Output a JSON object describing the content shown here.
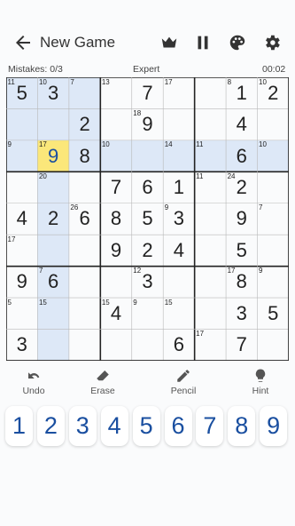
{
  "header": {
    "title": "New Game"
  },
  "status": {
    "mistakes": "Mistakes: 0/3",
    "difficulty": "Expert",
    "timer": "00:02"
  },
  "icons": {
    "back": "arrow-left-icon",
    "crown": "crown-icon",
    "pause": "pause-icon",
    "theme": "palette-icon",
    "settings": "gear-icon"
  },
  "colors": {
    "accent": "#1a4fa0",
    "selected": "#fbe77a",
    "highlight": "#dde8f7",
    "gridline": "#222222"
  },
  "grid": [
    [
      "5",
      "3",
      "",
      "",
      "7",
      "",
      "",
      "1",
      "2"
    ],
    [
      "",
      "",
      "2",
      "",
      "9",
      "",
      "",
      "4",
      ""
    ],
    [
      "",
      "9",
      "8",
      "",
      "",
      "",
      "",
      "6",
      ""
    ],
    [
      "",
      "",
      "",
      "7",
      "6",
      "1",
      "",
      "2",
      ""
    ],
    [
      "4",
      "2",
      "6",
      "8",
      "5",
      "3",
      "",
      "9",
      ""
    ],
    [
      "",
      "",
      "",
      "9",
      "2",
      "4",
      "",
      "5",
      ""
    ],
    [
      "9",
      "6",
      "",
      "",
      "3",
      "",
      "",
      "8",
      ""
    ],
    [
      "",
      "",
      "",
      "4",
      "",
      "",
      "",
      "3",
      "5"
    ],
    [
      "3",
      "",
      "",
      "",
      "",
      "6",
      "",
      "7",
      ""
    ]
  ],
  "selected_cell": [
    2,
    1
  ],
  "cage_sums": [
    {
      "r": 0,
      "c": 0,
      "v": "11"
    },
    {
      "r": 0,
      "c": 1,
      "v": "10"
    },
    {
      "r": 0,
      "c": 2,
      "v": "7"
    },
    {
      "r": 0,
      "c": 3,
      "v": "13"
    },
    {
      "r": 0,
      "c": 5,
      "v": "17"
    },
    {
      "r": 0,
      "c": 7,
      "v": "8"
    },
    {
      "r": 0,
      "c": 8,
      "v": "10"
    },
    {
      "r": 1,
      "c": 4,
      "v": "18"
    },
    {
      "r": 2,
      "c": 0,
      "v": "9"
    },
    {
      "r": 2,
      "c": 1,
      "v": "17"
    },
    {
      "r": 2,
      "c": 3,
      "v": "10"
    },
    {
      "r": 2,
      "c": 5,
      "v": "14"
    },
    {
      "r": 2,
      "c": 6,
      "v": "11"
    },
    {
      "r": 2,
      "c": 8,
      "v": "10"
    },
    {
      "r": 3,
      "c": 1,
      "v": "20"
    },
    {
      "r": 3,
      "c": 6,
      "v": "11"
    },
    {
      "r": 3,
      "c": 7,
      "v": "24"
    },
    {
      "r": 4,
      "c": 2,
      "v": "26"
    },
    {
      "r": 4,
      "c": 5,
      "v": "9"
    },
    {
      "r": 4,
      "c": 8,
      "v": "7"
    },
    {
      "r": 5,
      "c": 0,
      "v": "17"
    },
    {
      "r": 6,
      "c": 1,
      "v": "7"
    },
    {
      "r": 6,
      "c": 4,
      "v": "12"
    },
    {
      "r": 6,
      "c": 7,
      "v": "17"
    },
    {
      "r": 6,
      "c": 8,
      "v": "9"
    },
    {
      "r": 7,
      "c": 0,
      "v": "5"
    },
    {
      "r": 7,
      "c": 1,
      "v": "15"
    },
    {
      "r": 7,
      "c": 3,
      "v": "15"
    },
    {
      "r": 7,
      "c": 4,
      "v": "9"
    },
    {
      "r": 7,
      "c": 5,
      "v": "15"
    },
    {
      "r": 8,
      "c": 6,
      "v": "17"
    }
  ],
  "tools": [
    {
      "label": "Undo",
      "icon": "undo-icon"
    },
    {
      "label": "Erase",
      "icon": "eraser-icon"
    },
    {
      "label": "Pencil",
      "icon": "pencil-icon"
    },
    {
      "label": "Hint",
      "icon": "lightbulb-icon"
    }
  ],
  "numpad": [
    "1",
    "2",
    "3",
    "4",
    "5",
    "6",
    "7",
    "8",
    "9"
  ]
}
